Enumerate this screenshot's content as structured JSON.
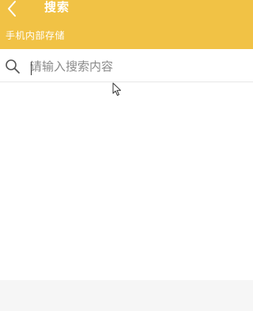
{
  "header": {
    "title": "搜索",
    "back_icon": "chevron-left-icon",
    "background_color": "#f1c245"
  },
  "location": {
    "label": "手机内部存储"
  },
  "search": {
    "icon": "search-icon",
    "placeholder": "请输入搜索内容",
    "value": ""
  }
}
